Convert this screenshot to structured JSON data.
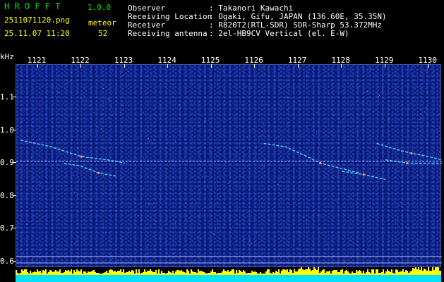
{
  "app": {
    "name": "H R O F F T",
    "version": "1.0.0"
  },
  "capture": {
    "filename": "2511071120.png",
    "datetime": "25.11.07 11:20"
  },
  "meteor": {
    "label": "meteor",
    "count": "52"
  },
  "info": {
    "rows": [
      {
        "key": "Observer",
        "value": ": Takanori Kawachi"
      },
      {
        "key": "Receiving Location",
        "value": ": Ogaki, Gifu, JAPAN (136.60E, 35.35N)"
      },
      {
        "key": "Receiver",
        "value": ": R820T2(RTL-SDR) SDR-Sharp 53.372MHz"
      },
      {
        "key": "Receiving antenna",
        "value": ": 2el-HB9CV Vertical (el. E-W)"
      }
    ]
  },
  "colors": {
    "header_green": "#00e000",
    "header_yellow": "#ffff00",
    "spectrogram_bg": "#0a1a78",
    "trace_cyan": "#55e0ff",
    "bar_yellow": "#ffff00",
    "bar_cyan": "#00e0ff"
  },
  "chart_data": {
    "type": "heatmap",
    "ylabel": "kHz",
    "y_ticks": [
      "1.1",
      "1.0",
      "0.9",
      "0.8",
      "0.7",
      "0.6"
    ],
    "x_ticks": [
      "1121",
      "1122",
      "1123",
      "1124",
      "1125",
      "1126",
      "1127",
      "1128",
      "1129",
      "1130"
    ],
    "ylim": [
      0.58,
      1.2
    ],
    "xlim": [
      1120.5,
      1130.3
    ],
    "carrier_khz": 0.905,
    "meteor_traces": [
      {
        "points": [
          [
            1120.6,
            0.97
          ],
          [
            1121.3,
            0.95
          ],
          [
            1122.0,
            0.92
          ],
          [
            1122.6,
            0.91
          ],
          [
            1123.0,
            0.9
          ]
        ]
      },
      {
        "points": [
          [
            1121.6,
            0.9
          ],
          [
            1122.0,
            0.89
          ],
          [
            1122.4,
            0.87
          ],
          [
            1122.8,
            0.86
          ]
        ]
      },
      {
        "points": [
          [
            1126.2,
            0.96
          ],
          [
            1126.7,
            0.95
          ],
          [
            1127.2,
            0.92
          ],
          [
            1127.5,
            0.9
          ],
          [
            1128.1,
            0.88
          ],
          [
            1128.4,
            0.87
          ]
        ]
      },
      {
        "points": [
          [
            1128.8,
            0.96
          ],
          [
            1129.3,
            0.94
          ],
          [
            1129.6,
            0.93
          ],
          [
            1130.0,
            0.92
          ],
          [
            1130.3,
            0.91
          ]
        ]
      },
      {
        "points": [
          [
            1129.0,
            0.91
          ],
          [
            1129.5,
            0.9
          ],
          [
            1130.3,
            0.9
          ]
        ]
      },
      {
        "points": [
          [
            1128.0,
            0.875
          ],
          [
            1128.5,
            0.865
          ],
          [
            1129.0,
            0.85
          ]
        ]
      }
    ]
  }
}
